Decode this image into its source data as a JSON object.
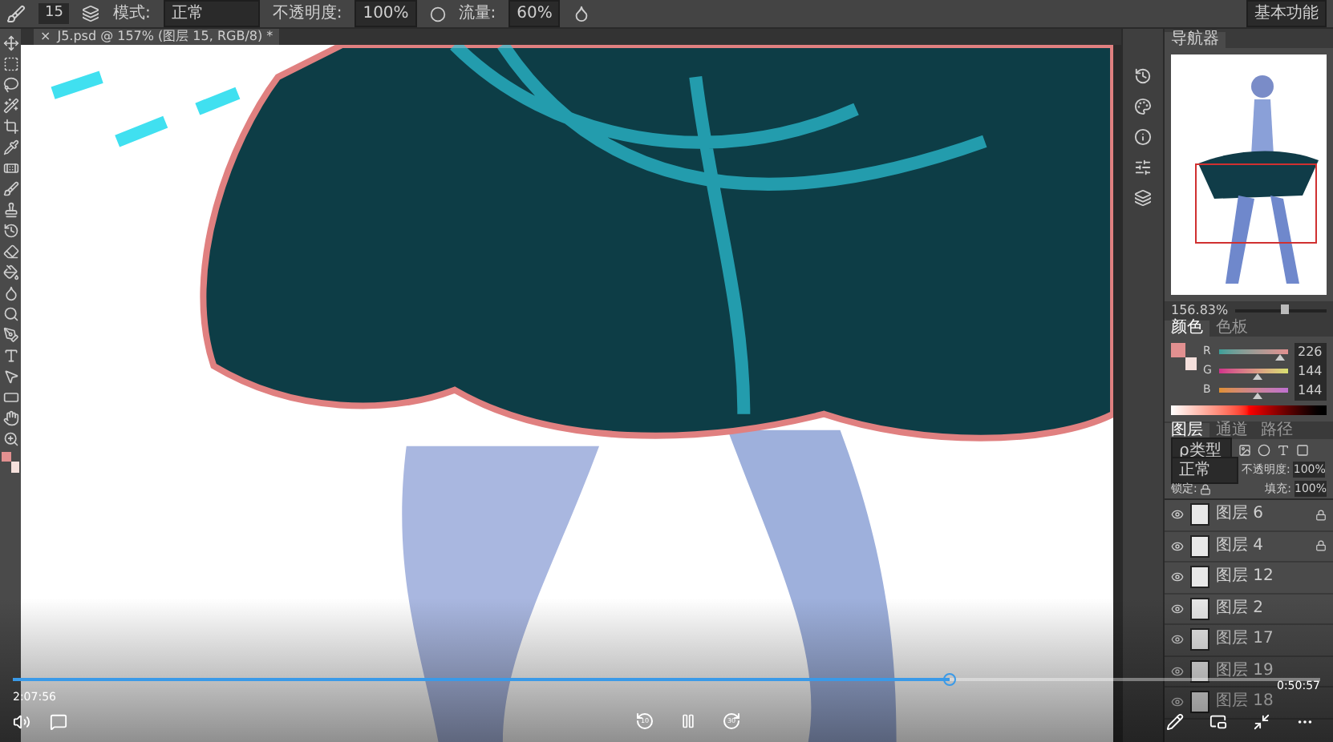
{
  "options_bar": {
    "brush_size": "15",
    "mode_label": "模式:",
    "mode": "正常",
    "opacity_label": "不透明度:",
    "opacity": "100%",
    "flow_label": "流量:",
    "flow": "60%",
    "workspace": "基本功能"
  },
  "document_tab": {
    "close": "×",
    "title": "J5.psd @ 157% (图层 15, RGB/8) *"
  },
  "navigator": {
    "tab": "导航器",
    "zoom": "156.83%",
    "level": 0.55
  },
  "color": {
    "tabs": [
      {
        "label": "颜色",
        "selected": true
      },
      {
        "label": "色板",
        "selected": false
      }
    ],
    "swatches": [
      {
        "kind": "foreground",
        "color": "#e29090"
      },
      {
        "kind": "background",
        "color": "#f5e0dc"
      }
    ],
    "channels": [
      {
        "name": "R",
        "value": "226",
        "level": 0.886
      },
      {
        "name": "G",
        "value": "144",
        "level": 0.565
      },
      {
        "name": "B",
        "value": "144",
        "level": 0.565
      }
    ]
  },
  "layers": {
    "tabs": [
      {
        "label": "图层",
        "selected": true
      },
      {
        "label": "通道",
        "selected": false
      },
      {
        "label": "路径",
        "selected": false
      }
    ],
    "filter": "ρ类型",
    "blend_mode": "正常",
    "opacity_label": "不透明度:",
    "opacity": "100%",
    "lock_label": "锁定:",
    "fill_label": "填充:",
    "fill": "100%",
    "items": [
      {
        "name": "图层 6",
        "locked": true
      },
      {
        "name": "图层 4",
        "locked": true
      },
      {
        "name": "图层 12",
        "locked": false
      },
      {
        "name": "图层 2",
        "locked": false
      },
      {
        "name": "图层 17",
        "locked": false
      },
      {
        "name": "图层 19",
        "locked": false
      },
      {
        "name": "图层 18",
        "locked": false
      }
    ]
  },
  "player": {
    "elapsed": "2:07:56",
    "remaining": "0:50:57",
    "level": 0.717,
    "rewind": "10",
    "forward": "30",
    "playing": true
  }
}
